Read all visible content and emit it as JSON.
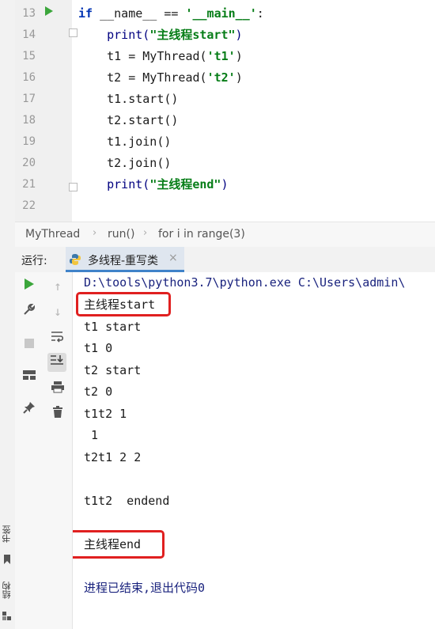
{
  "editor": {
    "lines": [
      {
        "num": "13",
        "parts": [
          {
            "t": "if",
            "c": "kw"
          },
          {
            "t": " __name__ == ",
            "c": ""
          },
          {
            "t": "'__main__'",
            "c": "str"
          },
          {
            "t": ":",
            "c": ""
          }
        ]
      },
      {
        "num": "14",
        "parts": [
          {
            "t": "    print(",
            "c": "fn"
          },
          {
            "t": "\"主线程start\"",
            "c": "str"
          },
          {
            "t": ")",
            "c": "fn"
          }
        ]
      },
      {
        "num": "15",
        "parts": [
          {
            "t": "    t1 = MyThread(",
            "c": ""
          },
          {
            "t": "'t1'",
            "c": "str"
          },
          {
            "t": ")",
            "c": ""
          }
        ]
      },
      {
        "num": "16",
        "parts": [
          {
            "t": "    t2 = MyThread(",
            "c": ""
          },
          {
            "t": "'t2'",
            "c": "str"
          },
          {
            "t": ")",
            "c": ""
          }
        ]
      },
      {
        "num": "17",
        "parts": [
          {
            "t": "    t1.start()",
            "c": ""
          }
        ]
      },
      {
        "num": "18",
        "parts": [
          {
            "t": "    t2.start()",
            "c": ""
          }
        ]
      },
      {
        "num": "19",
        "parts": [
          {
            "t": "    t1.join()",
            "c": ""
          }
        ]
      },
      {
        "num": "20",
        "parts": [
          {
            "t": "    t2.join()",
            "c": ""
          }
        ]
      },
      {
        "num": "21",
        "parts": [
          {
            "t": "    print(",
            "c": "fn"
          },
          {
            "t": "\"主线程end\"",
            "c": "str"
          },
          {
            "t": ")",
            "c": "fn"
          }
        ]
      },
      {
        "num": "22",
        "parts": []
      }
    ]
  },
  "breadcrumb": {
    "items": [
      "MyThread",
      "run()",
      "for i in range(3)"
    ]
  },
  "run_panel": {
    "label": "运行:",
    "tab_title": "多线程-重写类",
    "close_glyph": "×"
  },
  "console": {
    "command": "D:\\tools\\python3.7\\python.exe C:\\Users\\admin\\",
    "output": [
      "主线程start",
      "t1 start",
      "t1 0",
      "t2 start",
      "t2 0",
      "t1t2 1",
      " 1",
      "t2t1 2 2",
      "",
      "t1t2  endend",
      "",
      "主线程end",
      "",
      "进程已结束,退出代码0"
    ]
  },
  "side_tabs": {
    "bookmarks": "书签",
    "structure": "结构"
  },
  "icons": {
    "run": "run-icon",
    "wrench": "wrench-icon",
    "stop": "stop-icon",
    "layout": "layout-icon",
    "pin": "pin-icon",
    "up": "arrow-up-icon",
    "down": "arrow-down-icon",
    "wrap": "soft-wrap-icon",
    "scroll": "scroll-to-end-icon",
    "print": "print-icon",
    "trash": "trash-icon"
  },
  "colors": {
    "highlight": "#e02020",
    "run_green": "#3ba63b",
    "tab_underline": "#4083c9"
  }
}
